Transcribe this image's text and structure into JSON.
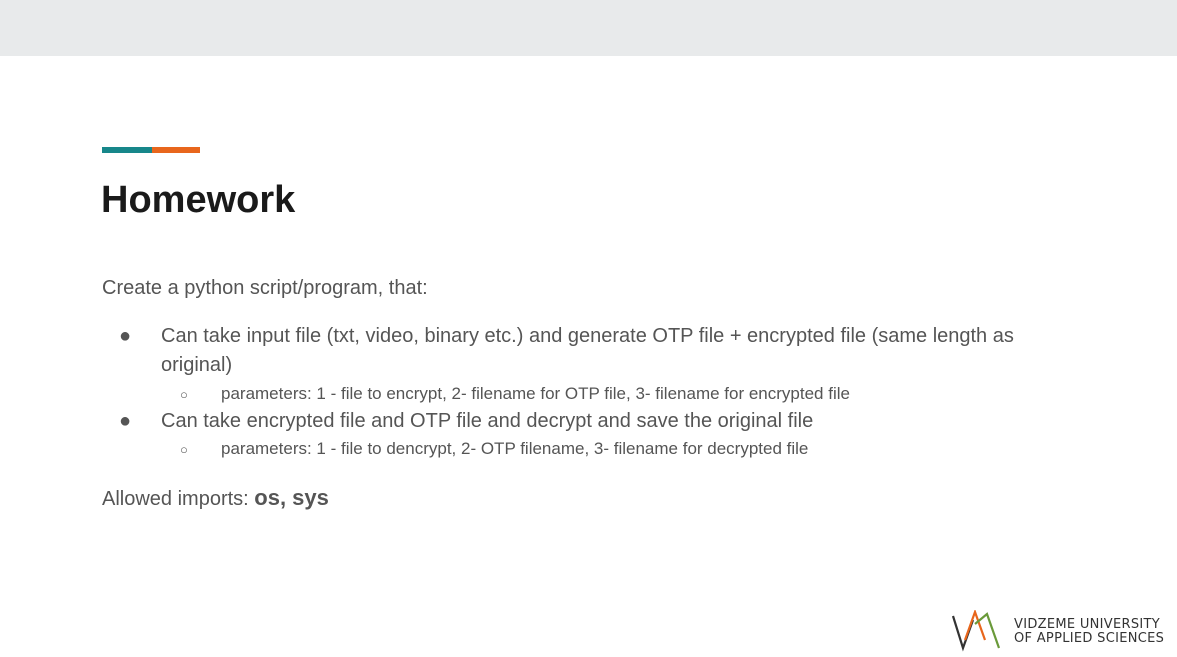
{
  "colors": {
    "accent_teal": "#17878a",
    "accent_orange": "#e8661c",
    "logo_green": "#6a9a3a",
    "logo_orange": "#e8661c",
    "logo_dark": "#333333"
  },
  "slide": {
    "title": "Homework",
    "intro": "Create a python script/program, that:",
    "bullets": [
      {
        "text": "Can take input file (txt, video, binary etc.) and generate OTP file + encrypted file (same length as original)",
        "sub": "parameters: 1 - file to encrypt, 2- filename for OTP file, 3- filename for encrypted file"
      },
      {
        "text": "Can take encrypted file and OTP file and decrypt and save the original file",
        "sub": "parameters: 1 - file to dencrypt, 2- OTP filename, 3- filename for decrypted file"
      }
    ],
    "bullet_glyph": "●",
    "sub_bullet_glyph": "○",
    "allowed_label": "Allowed imports: ",
    "allowed_value": "os, sys"
  },
  "logo": {
    "icon": "vidzeme-logo-icon",
    "line1": "VIDZEME UNIVERSITY",
    "line2": "OF APPLIED SCIENCES"
  }
}
